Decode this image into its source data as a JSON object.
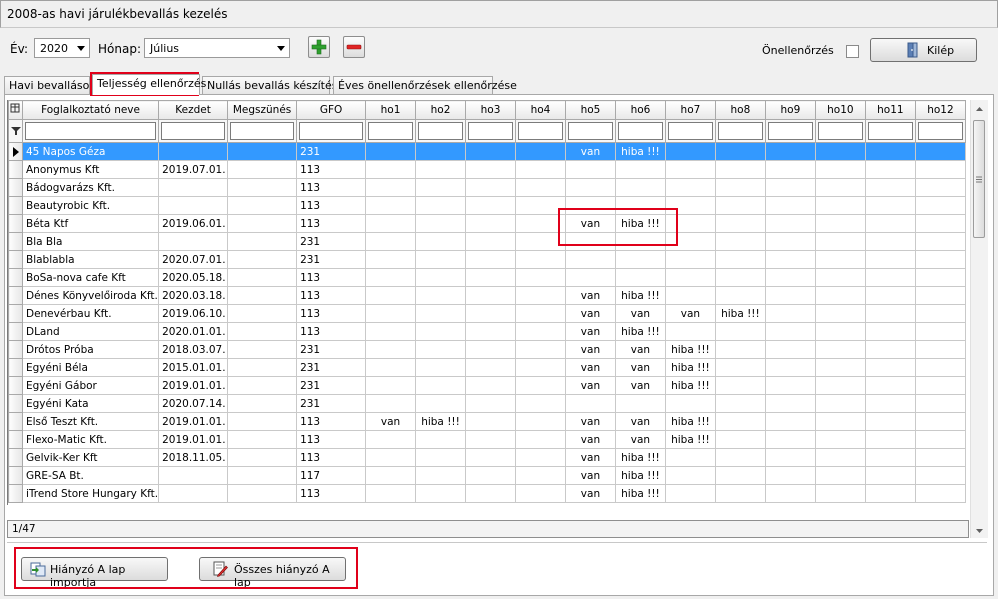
{
  "window": {
    "title": "2008-as havi járulékbevallás kezelés"
  },
  "toolbar": {
    "year_label": "Év:",
    "year_value": "2020",
    "month_label": "Hónap:",
    "month_value": "Július",
    "self_check_label": "Önellenőrzés",
    "exit_label": "Kilép"
  },
  "tabs": [
    {
      "label": "Havi bevallások"
    },
    {
      "label": "Teljesség ellenőrzés"
    },
    {
      "label": "Nullás bevallás készítése"
    },
    {
      "label": "Éves önellenőrzések ellenőrzése"
    }
  ],
  "grid": {
    "columns": [
      "Foglalkoztató neve",
      "Kezdet",
      "Megszünés",
      "GFO",
      "ho1",
      "ho2",
      "ho3",
      "ho4",
      "ho5",
      "ho6",
      "ho7",
      "ho8",
      "ho9",
      "ho10",
      "ho11",
      "ho12"
    ],
    "rows": [
      [
        "45 Napos Géza",
        "",
        "",
        "231",
        "",
        "",
        "",
        "",
        "van",
        "hiba !!!",
        "",
        "",
        "",
        "",
        "",
        ""
      ],
      [
        "Anonymus Kft",
        "2019.07.01.",
        "",
        "113",
        "",
        "",
        "",
        "",
        "",
        "",
        "",
        "",
        "",
        "",
        "",
        ""
      ],
      [
        "Bádogvarázs Kft.",
        "",
        "",
        "113",
        "",
        "",
        "",
        "",
        "",
        "",
        "",
        "",
        "",
        "",
        "",
        ""
      ],
      [
        "Beautyrobic Kft.",
        "",
        "",
        "113",
        "",
        "",
        "",
        "",
        "",
        "",
        "",
        "",
        "",
        "",
        "",
        ""
      ],
      [
        "Béta Ktf",
        "2019.06.01.",
        "",
        "113",
        "",
        "",
        "",
        "",
        "van",
        "hiba !!!",
        "",
        "",
        "",
        "",
        "",
        ""
      ],
      [
        "Bla Bla",
        "",
        "",
        "231",
        "",
        "",
        "",
        "",
        "",
        "",
        "",
        "",
        "",
        "",
        "",
        ""
      ],
      [
        "Blablabla",
        "2020.07.01.",
        "",
        "231",
        "",
        "",
        "",
        "",
        "",
        "",
        "",
        "",
        "",
        "",
        "",
        ""
      ],
      [
        "BoSa-nova cafe Kft",
        "2020.05.18.",
        "",
        "113",
        "",
        "",
        "",
        "",
        "",
        "",
        "",
        "",
        "",
        "",
        "",
        ""
      ],
      [
        "Dénes Könyvelőiroda Kft.",
        "2020.03.18.",
        "",
        "113",
        "",
        "",
        "",
        "",
        "van",
        "hiba !!!",
        "",
        "",
        "",
        "",
        "",
        ""
      ],
      [
        "Denevérbau Kft.",
        "2019.06.10.",
        "",
        "113",
        "",
        "",
        "",
        "",
        "van",
        "van",
        "van",
        "hiba !!!",
        "",
        "",
        "",
        ""
      ],
      [
        "DLand",
        "2020.01.01.",
        "",
        "113",
        "",
        "",
        "",
        "",
        "van",
        "hiba !!!",
        "",
        "",
        "",
        "",
        "",
        ""
      ],
      [
        "Drótos Próba",
        "2018.03.07.",
        "",
        "231",
        "",
        "",
        "",
        "",
        "van",
        "van",
        "hiba !!!",
        "",
        "",
        "",
        "",
        ""
      ],
      [
        "Egyéni Béla",
        "2015.01.01.",
        "",
        "231",
        "",
        "",
        "",
        "",
        "van",
        "van",
        "hiba !!!",
        "",
        "",
        "",
        "",
        ""
      ],
      [
        "Egyéni Gábor",
        "2019.01.01.",
        "",
        "231",
        "",
        "",
        "",
        "",
        "van",
        "van",
        "hiba !!!",
        "",
        "",
        "",
        "",
        ""
      ],
      [
        "Egyéni Kata",
        "2020.07.14.",
        "",
        "231",
        "",
        "",
        "",
        "",
        "",
        "",
        "",
        "",
        "",
        "",
        "",
        ""
      ],
      [
        "Első Teszt Kft.",
        "2019.01.01.",
        "",
        "113",
        "van",
        "hiba !!!",
        "",
        "",
        "van",
        "van",
        "hiba !!!",
        "",
        "",
        "",
        "",
        ""
      ],
      [
        "Flexo-Matic Kft.",
        "2019.01.01.",
        "",
        "113",
        "",
        "",
        "",
        "",
        "van",
        "van",
        "hiba !!!",
        "",
        "",
        "",
        "",
        ""
      ],
      [
        "Gelvik-Ker Kft",
        "2018.11.05.",
        "",
        "113",
        "",
        "",
        "",
        "",
        "van",
        "hiba !!!",
        "",
        "",
        "",
        "",
        "",
        ""
      ],
      [
        "GRE-SA Bt.",
        "",
        "",
        "117",
        "",
        "",
        "",
        "",
        "van",
        "hiba !!!",
        "",
        "",
        "",
        "",
        "",
        ""
      ],
      [
        "iTrend Store Hungary Kft.",
        "",
        "",
        "113",
        "",
        "",
        "",
        "",
        "van",
        "hiba !!!",
        "",
        "",
        "",
        "",
        "",
        ""
      ]
    ]
  },
  "status": {
    "record_position": "1/47"
  },
  "bottom": {
    "import_button": "Hiányzó A lap importja",
    "all_missing_button": "Összes hiányzó A lap"
  },
  "colors": {
    "selection": "#3399ff",
    "highlight_box": "#e0001a"
  }
}
